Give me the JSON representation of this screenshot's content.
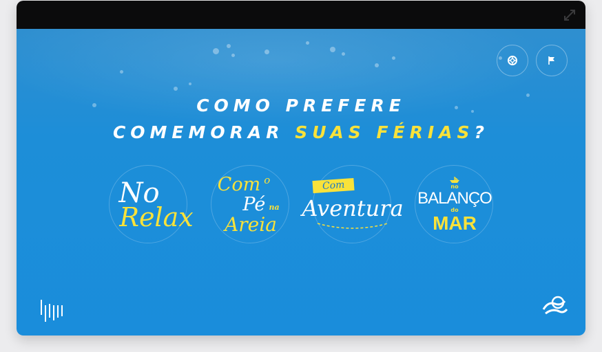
{
  "headline": {
    "line1": "COMO PREFERE",
    "line2_prefix": "COMEMORAR ",
    "line2_highlight": "SUAS FÉRIAS",
    "line2_suffix": "?"
  },
  "options": [
    {
      "w1": "No",
      "w2": "Relax"
    },
    {
      "w1": "Com",
      "w2": "o",
      "w3": "Pé",
      "w4": "na",
      "w5": "Areia"
    },
    {
      "w1": "Com",
      "w2": "Aventura"
    },
    {
      "w1": "no",
      "w2": "BALANÇO",
      "w3": "do",
      "w4": "MAR"
    }
  ],
  "icons": {
    "help": "lifebuoy-icon",
    "flag": "flag-icon",
    "expand": "expand-icon",
    "brand_left": "bars-logo",
    "brand_right": "wave-logo"
  },
  "colors": {
    "water": "#1a8ddb",
    "accent_yellow": "#f9e23a",
    "titlebar": "#0b0b0c"
  }
}
